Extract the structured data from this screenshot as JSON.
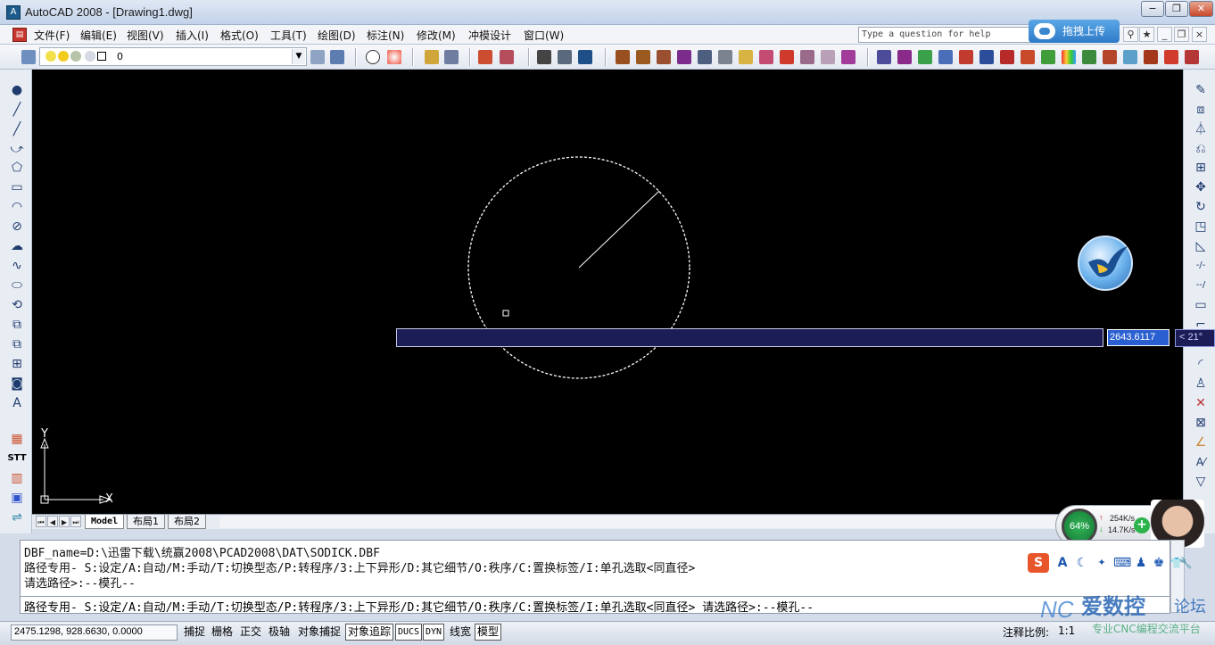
{
  "window": {
    "title": "AutoCAD 2008 - [Drawing1.dwg]",
    "app_icon_glyph": "A",
    "controls": {
      "minimize": "−",
      "restore": "❐",
      "close": "✕"
    }
  },
  "menubar": {
    "items": [
      "文件(F)",
      "编辑(E)",
      "视图(V)",
      "插入(I)",
      "格式(O)",
      "工具(T)",
      "绘图(D)",
      "标注(N)",
      "修改(M)",
      "冲模设计",
      "窗口(W)"
    ],
    "help_placeholder": "Type a question for help",
    "cloud_upload_label": "拖拽上传",
    "doc_controls": {
      "minimize": "_",
      "restore": "❐",
      "close": "×"
    }
  },
  "toolbar": {
    "layer_name": "0",
    "combo_arrow": "▼"
  },
  "left_toolbar": {
    "icons": [
      "●",
      "╱",
      "╱",
      "⤻",
      "⬠",
      "▭",
      "◠",
      "⊘",
      "☁",
      "∿",
      "⬭",
      "⟲",
      "⧉",
      "⧉",
      "⊞",
      "◙",
      "A"
    ],
    "lower_icons": [
      "▦",
      "STT",
      "▥",
      "▣",
      "⇌"
    ]
  },
  "right_toolbar": {
    "icons": [
      "✎",
      "⧈",
      "⏃",
      "⎌",
      "⊞",
      "✥",
      "↻",
      "◳",
      "◺",
      "-/-",
      "--/",
      "▭",
      "⌐",
      "",
      "◜",
      "♙",
      "✕",
      "⊠",
      "∠",
      "A⁄",
      "▽"
    ]
  },
  "drawing": {
    "ucs": {
      "x_label": "X",
      "y_label": "Y"
    },
    "dynamic_input": {
      "value": "2643.6117",
      "angle": "< 21°"
    }
  },
  "layout_tabs": {
    "nav": [
      "⏮",
      "◀",
      "▶",
      "⏭"
    ],
    "tabs": [
      "Model",
      "布局1",
      "布局2"
    ],
    "active": "Model"
  },
  "network_widget": {
    "gauge": "64%",
    "upload": "254K/s",
    "download": "14.7K/s",
    "plus": "+"
  },
  "command": {
    "history": [
      "DBF_name=D:\\迅雷下载\\统赢2008\\PCAD2008\\DAT\\SODICK.DBF",
      "路径专用- S:设定/A:自动/M:手动/T:切换型态/P:转程序/3:上下异形/D:其它细节/O:秩序/C:置换标签/I:单孔选取<同直径>",
      "请选路径>:--模孔--"
    ],
    "current": "路径专用- S:设定/A:自动/M:手动/T:切换型态/P:转程序/3:上下异形/D:其它细节/O:秩序/C:置换标签/I:单孔选取<同直径> 请选路径>:--模孔--"
  },
  "ime_bar": {
    "icons": [
      "S",
      "A",
      "☾",
      "✦",
      "⌨",
      "♟",
      "♚",
      "👕",
      "🔧"
    ]
  },
  "statusbar": {
    "coordinates": "2475.1298, 928.6630, 0.0000",
    "buttons": [
      "捕捉",
      "栅格",
      "正交",
      "极轴",
      "对象捕捉",
      "对象追踪",
      "DUCS",
      "DYN",
      "线宽",
      "模型"
    ],
    "annotation_label": "注释比例:",
    "annotation_value": "1:1"
  },
  "watermark": {
    "nc": "NC",
    "main": "爱数控",
    "forum": "论坛",
    "sub": "专业CNC编程交流平台"
  }
}
